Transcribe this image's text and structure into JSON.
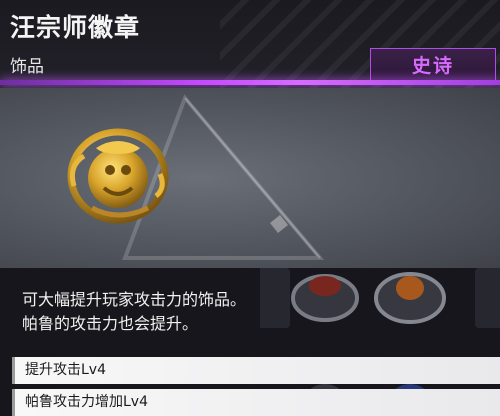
{
  "item": {
    "name": "汪宗师徽章",
    "category": "饰品",
    "rarity": "史诗",
    "rarity_color": "#d86bff",
    "description_line1": "可大幅提升玩家攻击力的饰品。",
    "description_line2": "帕鲁的攻击力也会提升。",
    "effects": [
      "提升攻击Lv4",
      "帕鲁攻击力增加Lv4"
    ]
  },
  "icons": [
    "golden-emblem-icon",
    "ring-icon"
  ]
}
